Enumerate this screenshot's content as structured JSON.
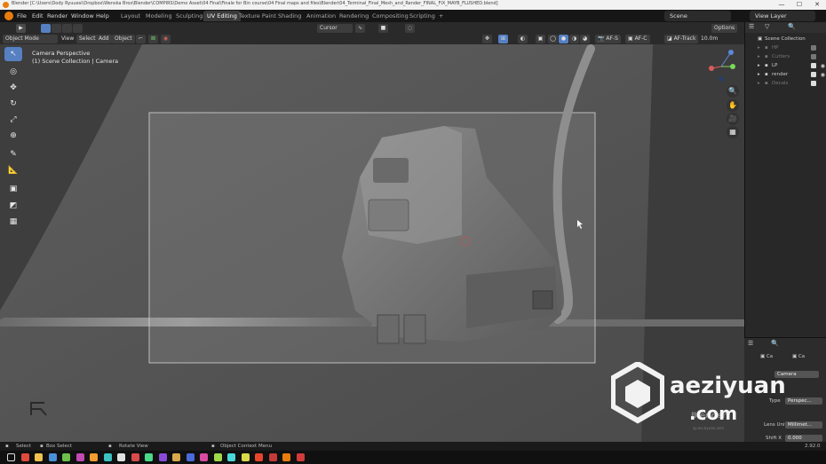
{
  "window": {
    "title": "Blender [C:\\Users\\Dody Ryuuesi\\Dropbox\\Wenska Bros\\Blender\\COMPIRS\\Demo Asset\\04 Final\\Finale for Bin course\\04 Final maps and files\\Blender\\04_Terminal_Final_Mesh_and_Render_FINAL_FIX_MAYB_FLUSHED.blend]",
    "min": "—",
    "max": "☐",
    "close": "✕"
  },
  "menu": [
    "File",
    "Edit",
    "Render",
    "Window",
    "Help"
  ],
  "workspaces": [
    "Layout",
    "Modeling",
    "Sculpting",
    "UV Editing",
    "Texture Paint",
    "Shading",
    "Animation",
    "Rendering",
    "Compositing",
    "Scripting"
  ],
  "active_workspace": "UV Editing",
  "add_tab": "+",
  "scene": "Scene",
  "view_layer": "View Layer",
  "header": {
    "mode": "Object Mode",
    "view": "View",
    "select": "Select",
    "add": "Add",
    "object": "Object",
    "pivot": "Cursor",
    "options": "Options",
    "af_s": "AF-S",
    "af_c": "AF-C",
    "af_track": "AF-Track",
    "distance": "10.0m"
  },
  "viewport": {
    "camera_perspective": "Camera Perspective",
    "collection": "(1) Scene Collection | Camera"
  },
  "tools": [
    "select-box",
    "cursor",
    "move",
    "rotate",
    "scale",
    "transform",
    "annotate",
    "measure",
    "add-cube",
    "camera-tool",
    "view-tool"
  ],
  "tool_glyphs": [
    "↖",
    "◎",
    "✥",
    "↻",
    "⤢",
    "⊕",
    "✎",
    "📐",
    "▣",
    "◩",
    "▦"
  ],
  "nav": {
    "zoom": "🔍",
    "pan": "✋",
    "camera": "🎥",
    "grid": "▦"
  },
  "outliner": {
    "title": "Scene Collection",
    "items": [
      {
        "label": "HP",
        "dim": true
      },
      {
        "label": "Cutters",
        "dim": true
      },
      {
        "label": "LP",
        "dim": false
      },
      {
        "label": "render",
        "dim": false
      },
      {
        "label": "Decals",
        "dim": true
      }
    ]
  },
  "properties": {
    "tab1": "Ca",
    "tab2": "Ca",
    "name": "Camera",
    "type_label": "Type",
    "type_value": "Perspec...",
    "lens_label": "Lens Unit",
    "lens_value": "Millimet...",
    "shift_label": "Shift X",
    "shift_value": "0.000"
  },
  "statusbar": {
    "select": "Select",
    "box_select": "Box Select",
    "rotate": "Rotate View",
    "context": "Object Context Menu",
    "version": "2.92.0"
  },
  "watermark": {
    "brand": "aeziyuan",
    "domain": ".com",
    "blender": "Blender",
    "small": "sp.ae.ziyuan.com"
  },
  "colors": {
    "accent": "#5680c2",
    "blender_orange": "#e87d0d",
    "viewport_bg": "#5a5a5a",
    "panel": "#282828"
  },
  "taskbar_icons": [
    {
      "name": "windows-start-icon",
      "color": "#dddddd"
    },
    {
      "name": "chrome-icon",
      "color": "#e04a3c"
    },
    {
      "name": "explorer-icon",
      "color": "#f2c14e"
    },
    {
      "name": "app-icon-1",
      "color": "#4a90d9"
    },
    {
      "name": "app-icon-2",
      "color": "#6cc04a"
    },
    {
      "name": "app-icon-3",
      "color": "#c04ab0"
    },
    {
      "name": "app-icon-4",
      "color": "#f29b30"
    },
    {
      "name": "app-icon-5",
      "color": "#3cc0c0"
    },
    {
      "name": "app-icon-6",
      "color": "#e0e0e0"
    },
    {
      "name": "app-icon-7",
      "color": "#d94a4a"
    },
    {
      "name": "app-icon-8",
      "color": "#4ad98a"
    },
    {
      "name": "app-icon-9",
      "color": "#8a4ad9"
    },
    {
      "name": "app-icon-10",
      "color": "#d9a84a"
    },
    {
      "name": "app-icon-11",
      "color": "#4a6ad9"
    },
    {
      "name": "app-icon-12",
      "color": "#d94aa0"
    },
    {
      "name": "app-icon-13",
      "color": "#a0d94a"
    },
    {
      "name": "app-icon-14",
      "color": "#4ad9d9"
    },
    {
      "name": "app-icon-15",
      "color": "#d9d94a"
    },
    {
      "name": "app-icon-16",
      "color": "#e8452c"
    },
    {
      "name": "app-icon-17",
      "color": "#c43a3a"
    },
    {
      "name": "app-icon-18",
      "color": "#e87d0d"
    },
    {
      "name": "app-icon-19",
      "color": "#d13b3b"
    }
  ]
}
